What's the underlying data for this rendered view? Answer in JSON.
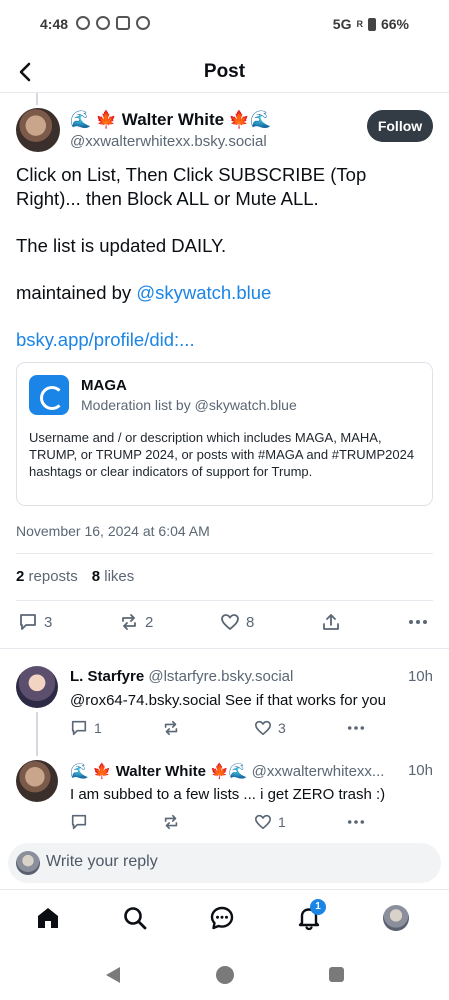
{
  "status_bar": {
    "time": "4:48",
    "network": "5G",
    "signal": "R",
    "battery": "66%"
  },
  "header": {
    "back_icon": "chevron-left-icon",
    "title": "Post"
  },
  "post": {
    "author_name": "🌊 🍁 Walter White 🍁🌊",
    "author_handle": "@xxwalterwhitexx.bsky.social",
    "follow_label": "Follow",
    "text_line1": "Click on List,  Then Click SUBSCRIBE (Top",
    "text_line2": "Right)... then Block ALL or Mute ALL.",
    "text_line3": "The list is updated DAILY.",
    "text_line4_prefix": "maintained by ",
    "text_line4_mention": "@skywatch.blue",
    "link": "bsky.app/profile/did:...",
    "embed": {
      "title": "MAGA",
      "subtitle": "Moderation list by @skywatch.blue",
      "description": "Username and / or description which includes MAGA, MAHA, TRUMP, or TRUMP 2024, or posts with #MAGA and #TRUMP2024 hashtags or clear indicators of support for Trump."
    },
    "timestamp": "November 16, 2024 at 6:04 AM",
    "reposts_count": "2",
    "reposts_label": "reposts",
    "likes_count": "8",
    "likes_label": "likes",
    "actions": {
      "reply_count": "3",
      "repost_count": "2",
      "like_count": "8"
    }
  },
  "replies": [
    {
      "name": "L. Starfyre",
      "handle": "@lstarfyre.bsky.social",
      "time": "10h",
      "text": "@rox64-74.bsky.social See if that works for you",
      "reply_count": "1",
      "repost_count": "",
      "like_count": "3"
    },
    {
      "name": "🌊 🍁 Walter White 🍁🌊",
      "handle": "@xxwalterwhitexx...",
      "time": "10h",
      "text": "I am subbed to a few lists ... i get ZERO trash :)",
      "reply_count": "",
      "repost_count": "",
      "like_count": "1"
    }
  ],
  "composer": {
    "placeholder": "Write your reply"
  },
  "tab_bar": {
    "notification_badge": "1"
  },
  "colors": {
    "accent": "#1a85e6",
    "follow_button": "#333b44",
    "muted_text": "#5b6774"
  }
}
